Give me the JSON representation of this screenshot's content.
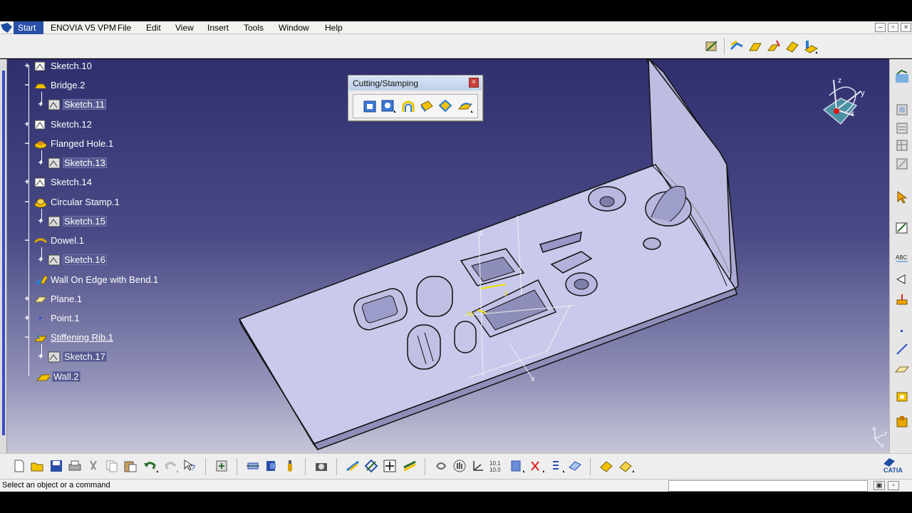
{
  "menubar": {
    "start": "Start",
    "items": [
      "ENOVIA V5 VPM",
      "File",
      "Edit",
      "View",
      "Insert",
      "Tools",
      "Window",
      "Help"
    ]
  },
  "tree": [
    {
      "label": "Sketch.10",
      "icon": "sketch-icon"
    },
    {
      "label": "Bridge.2",
      "icon": "bridge-icon"
    },
    {
      "label": "Sketch.11",
      "icon": "sketch-icon"
    },
    {
      "label": "Sketch.12",
      "icon": "sketch-icon"
    },
    {
      "label": "Flanged Hole.1",
      "icon": "flanged-hole-icon"
    },
    {
      "label": "Sketch.13",
      "icon": "sketch-icon"
    },
    {
      "label": "Sketch.14",
      "icon": "sketch-icon"
    },
    {
      "label": "Circular Stamp.1",
      "icon": "circular-stamp-icon"
    },
    {
      "label": "Sketch.15",
      "icon": "sketch-icon"
    },
    {
      "label": "Dowel.1",
      "icon": "dowel-icon"
    },
    {
      "label": "Sketch.16",
      "icon": "sketch-icon"
    },
    {
      "label": "Wall On Edge with Bend.1",
      "icon": "wall-on-edge-icon"
    },
    {
      "label": "Plane.1",
      "icon": "plane-icon"
    },
    {
      "label": "Point.1",
      "icon": "point-icon"
    },
    {
      "label": "Stiffening Rib.1",
      "icon": "stiffening-rib-icon"
    },
    {
      "label": "Sketch.17",
      "icon": "sketch-icon"
    },
    {
      "label": "Wall.2",
      "icon": "wall-icon"
    }
  ],
  "palette": {
    "title": "Cutting/Stamping",
    "close": "×",
    "icons": [
      "surface-stamp-icon",
      "bead-icon",
      "curve-stamp-icon",
      "flanged-cutout-icon",
      "louver-icon",
      "stiffening-rib-tool-icon"
    ]
  },
  "compass": {
    "x": "x",
    "y": "y",
    "z": "z"
  },
  "axis": {
    "x": "x",
    "y": "y",
    "z": "z"
  },
  "status": {
    "text": "Select an object or a command",
    "input_value": ""
  },
  "brand": "CATIA",
  "colors": {
    "viewport_top": "#2f2f6f",
    "viewport_bottom": "#c6c6d8",
    "part": "#c9c9ec",
    "highlight": "#2a4fa8"
  }
}
